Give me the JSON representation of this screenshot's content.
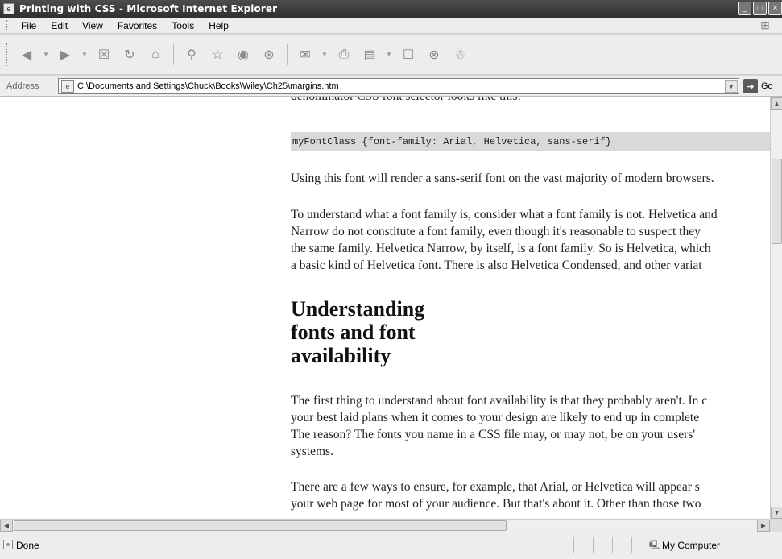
{
  "window": {
    "title": "Printing with CSS - Microsoft Internet Explorer",
    "controls": [
      "minimize",
      "maximize",
      "close"
    ]
  },
  "menubar": {
    "items": [
      "File",
      "Edit",
      "View",
      "Favorites",
      "Tools",
      "Help"
    ]
  },
  "toolbar": {
    "icons": [
      "back-icon",
      "forward-icon",
      "stop-icon",
      "refresh-icon",
      "home-icon",
      "search-icon",
      "favorites-icon",
      "media-icon",
      "history-icon",
      "mail-icon",
      "print-icon",
      "edit-icon",
      "discuss-icon",
      "research-icon",
      "messenger-icon"
    ]
  },
  "addressbar": {
    "label": "Address",
    "url": "C:\\Documents and Settings\\Chuck\\Books\\Wiley\\Ch25\\margins.htm",
    "go_label": "Go"
  },
  "content": {
    "cut_line": "denominator CSS font selector looks like this:",
    "code": "myFontClass {font-family: Arial, Helvetica, sans-serif}",
    "para1": "Using this font will render a sans-serif font on the vast majority of modern browsers.",
    "para2": [
      "To understand what a font family is, consider what a font family is not. Helvetica and",
      "Narrow do not constitute a font family, even though it's reasonable to suspect they",
      "the same family. Helvetica Narrow, by itself, is a font family. So is Helvetica, which",
      "a basic kind of Helvetica font. There is also Helvetica Condensed, and other variat"
    ],
    "heading": [
      "Understanding",
      "fonts and font",
      "availability"
    ],
    "para3": [
      "The first thing to understand about font availability is that they probably aren't. In c",
      "your best laid plans when it comes to your design are likely to end up in complete",
      "The reason? The fonts you name in a CSS file may, or may not, be on your users'",
      "systems."
    ],
    "para4": [
      "There are a few ways to ensure, for example, that Arial, or Helvetica will appear s",
      "your web page for most of your audience. But that's about it. Other than those two"
    ]
  },
  "statusbar": {
    "status": "Done",
    "zone": "My Computer"
  }
}
